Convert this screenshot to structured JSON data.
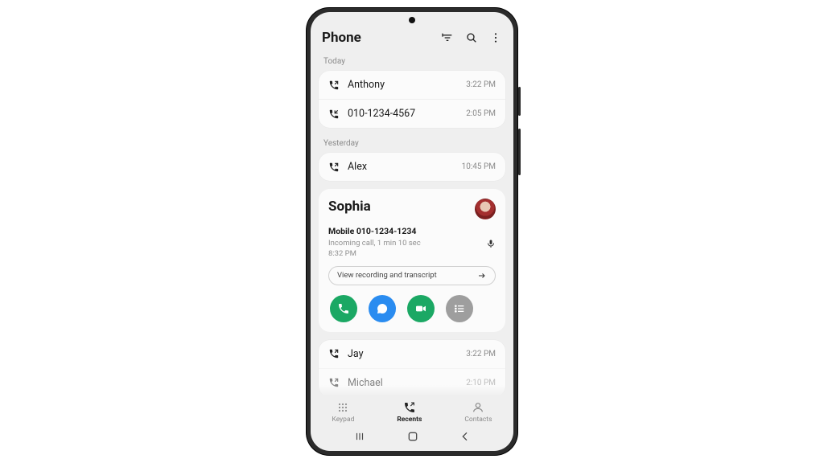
{
  "header": {
    "title": "Phone"
  },
  "sections": [
    {
      "label": "Today",
      "rows": [
        {
          "dir": "out",
          "name": "Anthony",
          "time": "3:22 PM"
        },
        {
          "dir": "in",
          "name": "010-1234-4567",
          "time": "2:05 PM"
        }
      ]
    },
    {
      "label": "Yesterday",
      "rows": [
        {
          "dir": "out",
          "name": "Alex",
          "time": "10:45 PM"
        }
      ]
    }
  ],
  "detail": {
    "name": "Sophia",
    "sub": "Mobile 010-1234-1234",
    "meta": "Incoming call, 1 min 10 sec",
    "time": "8:32 PM",
    "pill": "View recording and transcript"
  },
  "tail": [
    {
      "dir": "out",
      "name": "Jay",
      "time": "3:22 PM"
    },
    {
      "dir": "out",
      "name": "Michael",
      "time": "2:10 PM"
    }
  ],
  "tabs": {
    "keypad": "Keypad",
    "recents": "Recents",
    "contacts": "Contacts"
  }
}
